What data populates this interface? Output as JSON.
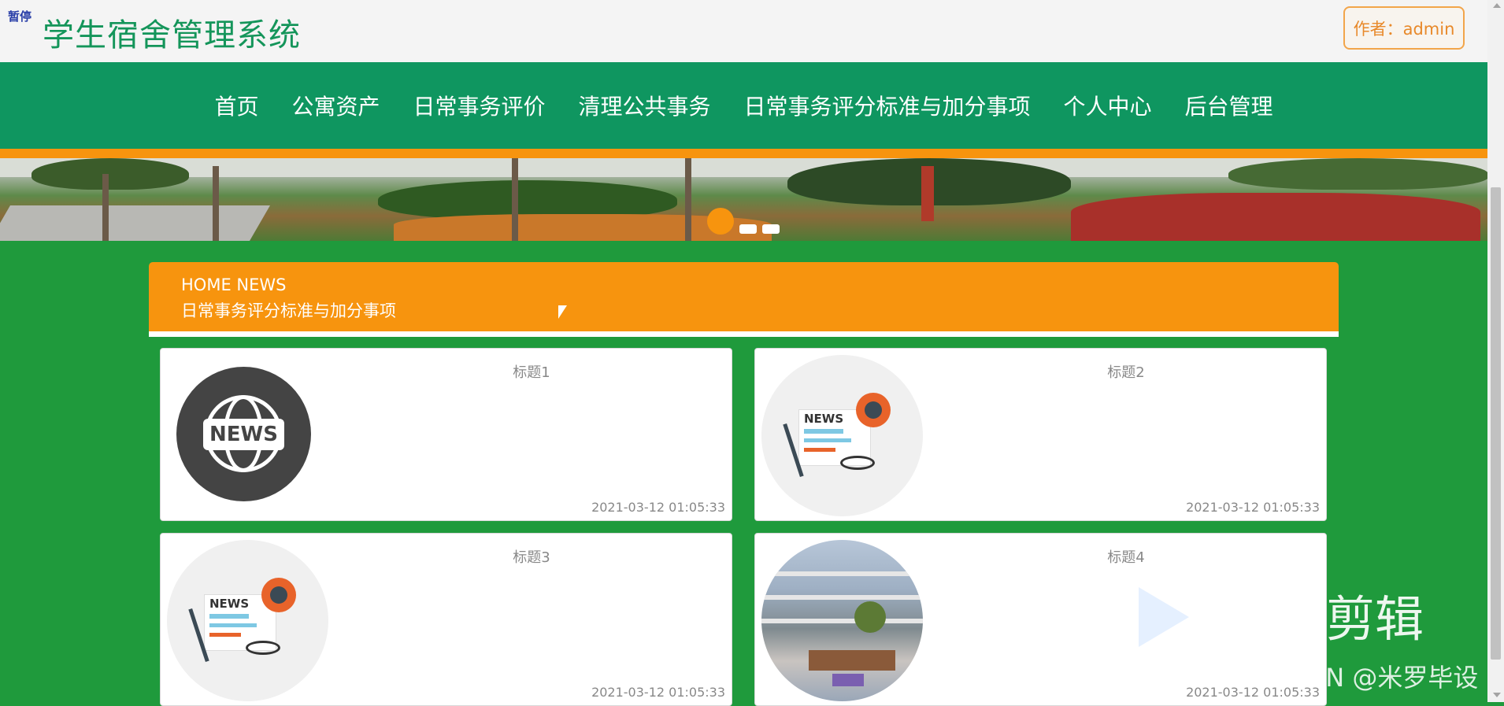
{
  "header": {
    "pause_tag": "暂停",
    "site_title": "学生宿舍管理系统",
    "author_label": "作者：admin"
  },
  "nav": {
    "items": [
      {
        "label": "首页"
      },
      {
        "label": "公寓资产"
      },
      {
        "label": "日常事务评价"
      },
      {
        "label": "清理公共事务"
      },
      {
        "label": "日常事务评分标准与加分事项"
      },
      {
        "label": "个人中心"
      },
      {
        "label": "后台管理"
      }
    ]
  },
  "carousel": {
    "active_index": 0,
    "slide_count": 3
  },
  "news_section": {
    "heading_en": "HOME NEWS",
    "heading_zh": "日常事务评分标准与加分事项"
  },
  "news_items": [
    {
      "title": "标题1",
      "date": "2021-03-12 01:05:33",
      "image": "news-globe-icon"
    },
    {
      "title": "标题2",
      "date": "2021-03-12 01:05:33",
      "image": "newspaper-icon"
    },
    {
      "title": "标题3",
      "date": "2021-03-12 01:05:33",
      "image": "newspaper-icon"
    },
    {
      "title": "标题4",
      "date": "2021-03-12 01:05:33",
      "image": "building-photo"
    }
  ],
  "overlay": {
    "clip_watermark": "剪辑",
    "csdn_watermark": "CSDN @米罗毕设"
  },
  "colors": {
    "page_bg": "#1f9a3c",
    "nav_bg": "#0f9660",
    "accent_orange": "#f7940e",
    "title_green": "#14955a"
  }
}
